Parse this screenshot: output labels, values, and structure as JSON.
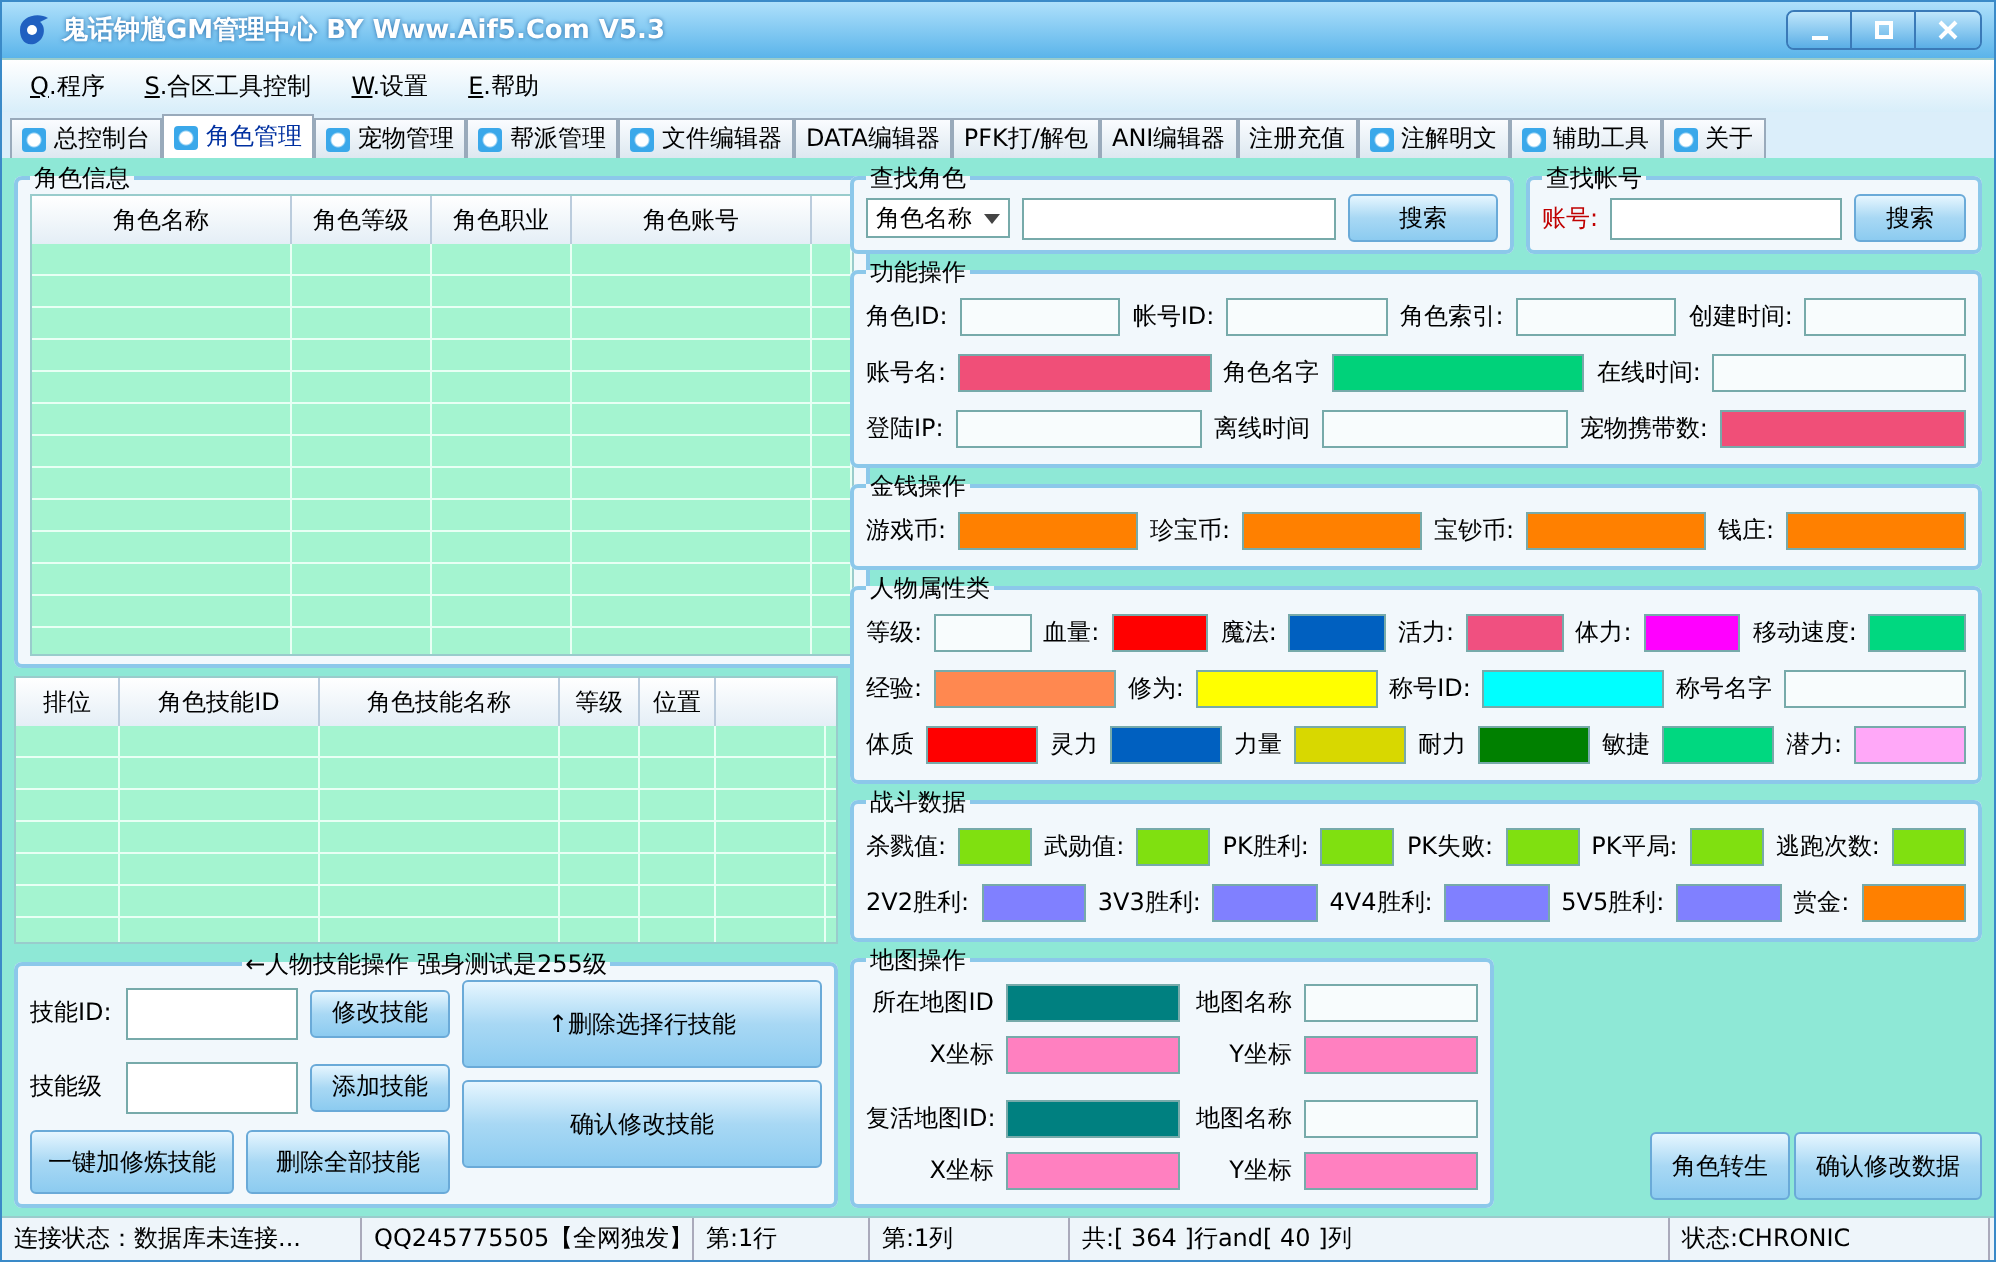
{
  "window": {
    "title": "鬼话钟馗GM管理中心 BY Www.Aif5.Com  V5.3"
  },
  "menu": [
    {
      "key": "Q",
      "label": ".程序"
    },
    {
      "key": "S",
      "label": ".合区工具控制"
    },
    {
      "key": "W",
      "label": ".设置"
    },
    {
      "key": "E",
      "label": ".帮助"
    }
  ],
  "tabs": [
    {
      "label": "总控制台",
      "selected": false,
      "dot": true
    },
    {
      "label": "角色管理",
      "selected": true,
      "dot": true
    },
    {
      "label": "宠物管理",
      "selected": false,
      "dot": true
    },
    {
      "label": "帮派管理",
      "selected": false,
      "dot": true
    },
    {
      "label": "文件编辑器",
      "selected": false,
      "dot": true
    },
    {
      "label": "DATA编辑器",
      "selected": false,
      "dot": false
    },
    {
      "label": "PFK打/解包",
      "selected": false,
      "dot": false
    },
    {
      "label": "ANI编辑器",
      "selected": false,
      "dot": false
    },
    {
      "label": "注册充值",
      "selected": false,
      "dot": false
    },
    {
      "label": "注解明文",
      "selected": false,
      "dot": true
    },
    {
      "label": "辅助工具",
      "selected": false,
      "dot": true
    },
    {
      "label": "关于",
      "selected": false,
      "dot": true
    }
  ],
  "role_info": {
    "title": "角色信息",
    "columns": [
      "角色名称",
      "角色等级",
      "角色职业",
      "角色账号"
    ]
  },
  "skills_table": {
    "columns": [
      "排位",
      "角色技能ID",
      "角色技能名称",
      "等级",
      "位置"
    ]
  },
  "skill_ops": {
    "title": "←人物技能操作 强身测试是255级",
    "fields": [
      {
        "label": "技能ID:",
        "button": "修改技能"
      },
      {
        "label": "技能级",
        "button": "添加技能"
      }
    ],
    "bottom_buttons": [
      "一键加修炼技能",
      "删除全部技能"
    ],
    "big_buttons": [
      "↑删除选择行技能",
      "确认修改技能"
    ]
  },
  "find_role": {
    "title": "查找角色",
    "select": "角色名称",
    "button": "搜索"
  },
  "find_account": {
    "title": "查找帐号",
    "label": "账号:",
    "button": "搜索"
  },
  "sections": [
    {
      "title": "功能操作",
      "lines": [
        {
          "fields": [
            {
              "label": "角色ID:"
            },
            {
              "label": "帐号ID:"
            },
            {
              "label": "角色索引:"
            },
            {
              "label": "创建时间:"
            }
          ]
        },
        {
          "fields": [
            {
              "label": "账号名:",
              "color": "#f04f78"
            },
            {
              "label": "角色名字",
              "color": "#00d27a"
            },
            {
              "label": "在线时间:"
            }
          ]
        },
        {
          "fields": [
            {
              "label": "登陆IP:"
            },
            {
              "label": "离线时间"
            },
            {
              "label": "宠物携带数:",
              "color": "#f04f78"
            }
          ]
        }
      ]
    },
    {
      "title": "金钱操作",
      "lines": [
        {
          "fields": [
            {
              "label": "游戏币:",
              "color": "#ff8000"
            },
            {
              "label": "珍宝币:",
              "color": "#ff8000"
            },
            {
              "label": "宝钞币:",
              "color": "#ff8000"
            },
            {
              "label": "钱庄:",
              "color": "#ff8000"
            }
          ]
        }
      ]
    },
    {
      "title": "人物属性类",
      "lines": [
        {
          "fields": [
            {
              "label": "等级:"
            },
            {
              "label": "血量:",
              "color": "#ff0000"
            },
            {
              "label": "魔法:",
              "color": "#0060c0"
            },
            {
              "label": "活力:",
              "color": "#f05080"
            },
            {
              "label": "体力:",
              "color": "#ff00ff"
            },
            {
              "label": "移动速度:",
              "color": "#00d880"
            }
          ]
        },
        {
          "fields": [
            {
              "label": "经验:",
              "color": "#ff8850"
            },
            {
              "label": "修为:",
              "color": "#ffff00"
            },
            {
              "label": "称号ID:",
              "color": "#00ffff"
            },
            {
              "label": "称号名字"
            }
          ]
        },
        {
          "fields": [
            {
              "label": "体质",
              "color": "#ff0000"
            },
            {
              "label": "灵力",
              "color": "#0060c0"
            },
            {
              "label": "力量",
              "color": "#d8d800"
            },
            {
              "label": "耐力",
              "color": "#008000"
            },
            {
              "label": "敏捷",
              "color": "#00d880"
            },
            {
              "label": "潜力:",
              "color": "#ffa8f8"
            }
          ]
        }
      ]
    },
    {
      "title": "战斗数据",
      "lines": [
        {
          "fields": [
            {
              "label": "杀戮值:",
              "color": "#80e010"
            },
            {
              "label": "武勋值:",
              "color": "#80e010"
            },
            {
              "label": "PK胜利:",
              "color": "#80e010"
            },
            {
              "label": "PK失败:",
              "color": "#80e010"
            },
            {
              "label": "PK平局:",
              "color": "#80e010"
            },
            {
              "label": "逃跑次数:",
              "color": "#80e010"
            }
          ]
        },
        {
          "fields": [
            {
              "label": "2V2胜利:",
              "color": "#8080ff"
            },
            {
              "label": "3V3胜利:",
              "color": "#8080ff"
            },
            {
              "label": "4V4胜利:",
              "color": "#8080ff"
            },
            {
              "label": "5V5胜利:",
              "color": "#8080ff"
            },
            {
              "label": "赏金:",
              "color": "#ff8000"
            }
          ]
        }
      ]
    }
  ],
  "map": {
    "title": "地图操作",
    "lines": [
      {
        "fields": [
          {
            "label": "所在地图ID",
            "color": "#008080"
          },
          {
            "label": "地图名称"
          }
        ]
      },
      {
        "fields": [
          {
            "label": "X坐标",
            "color": "#ff80c0"
          },
          {
            "label": "Y坐标",
            "color": "#ff80c0"
          }
        ]
      },
      {
        "fields": [
          {
            "label": "复活地图ID:",
            "color": "#008080"
          },
          {
            "label": "地图名称"
          }
        ]
      },
      {
        "fields": [
          {
            "label": "X坐标",
            "color": "#ff80c0"
          },
          {
            "label": "Y坐标",
            "color": "#ff80c0"
          }
        ]
      }
    ]
  },
  "actions": [
    "角色转生",
    "确认修改数据"
  ],
  "status_bar": [
    "连接状态：数据库未连接...",
    "QQ245775505【全网独发】",
    "第:1行",
    "第:1列",
    "共:[ 364 ]行and[ 40 ]列",
    "状态:CHRONIC"
  ]
}
